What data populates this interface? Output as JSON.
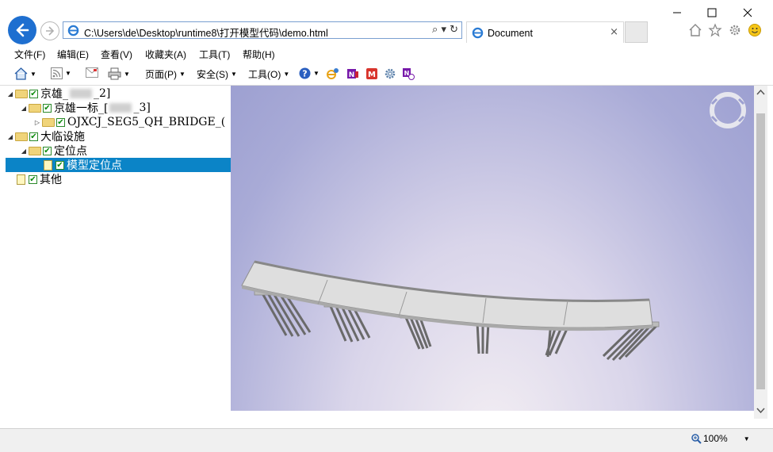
{
  "address": {
    "url": "C:\\Users\\de\\Desktop\\runtime8\\打开模型代码\\demo.html"
  },
  "tab": {
    "title": "Document",
    "close": "×"
  },
  "menu": [
    "文件(F)",
    "编辑(E)",
    "查看(V)",
    "收藏夹(A)",
    "工具(T)",
    "帮助(H)"
  ],
  "commands": {
    "page": "页面(P)",
    "safety": "安全(S)",
    "tools": "工具(O)"
  },
  "tree": [
    {
      "level": 0,
      "expanded": true,
      "icon": "folder",
      "prefix": "京雄_",
      "suffix": "_2]"
    },
    {
      "level": 1,
      "expanded": true,
      "icon": "folder",
      "prefix": "京雄一标_[",
      "suffix": "_3]"
    },
    {
      "level": 2,
      "expanded": false,
      "icon": "folder",
      "prefix": "OJXCJ_SEG5_QH_BRIDGE_(",
      "suffix": ""
    },
    {
      "level": 0,
      "expanded": true,
      "icon": "folder",
      "prefix": "大临设施",
      "suffix": ""
    },
    {
      "level": 1,
      "expanded": true,
      "icon": "folder",
      "prefix": "定位点",
      "suffix": ""
    },
    {
      "level": 2,
      "icon": "doc",
      "prefix": "模型定位点",
      "suffix": "",
      "selected": true
    },
    {
      "level": 0,
      "icon": "doc",
      "prefix": "其他",
      "suffix": ""
    }
  ],
  "status": {
    "zoom": "100%"
  },
  "colors": {
    "accent": "#1e6fd0",
    "selection": "#0b84c7"
  }
}
